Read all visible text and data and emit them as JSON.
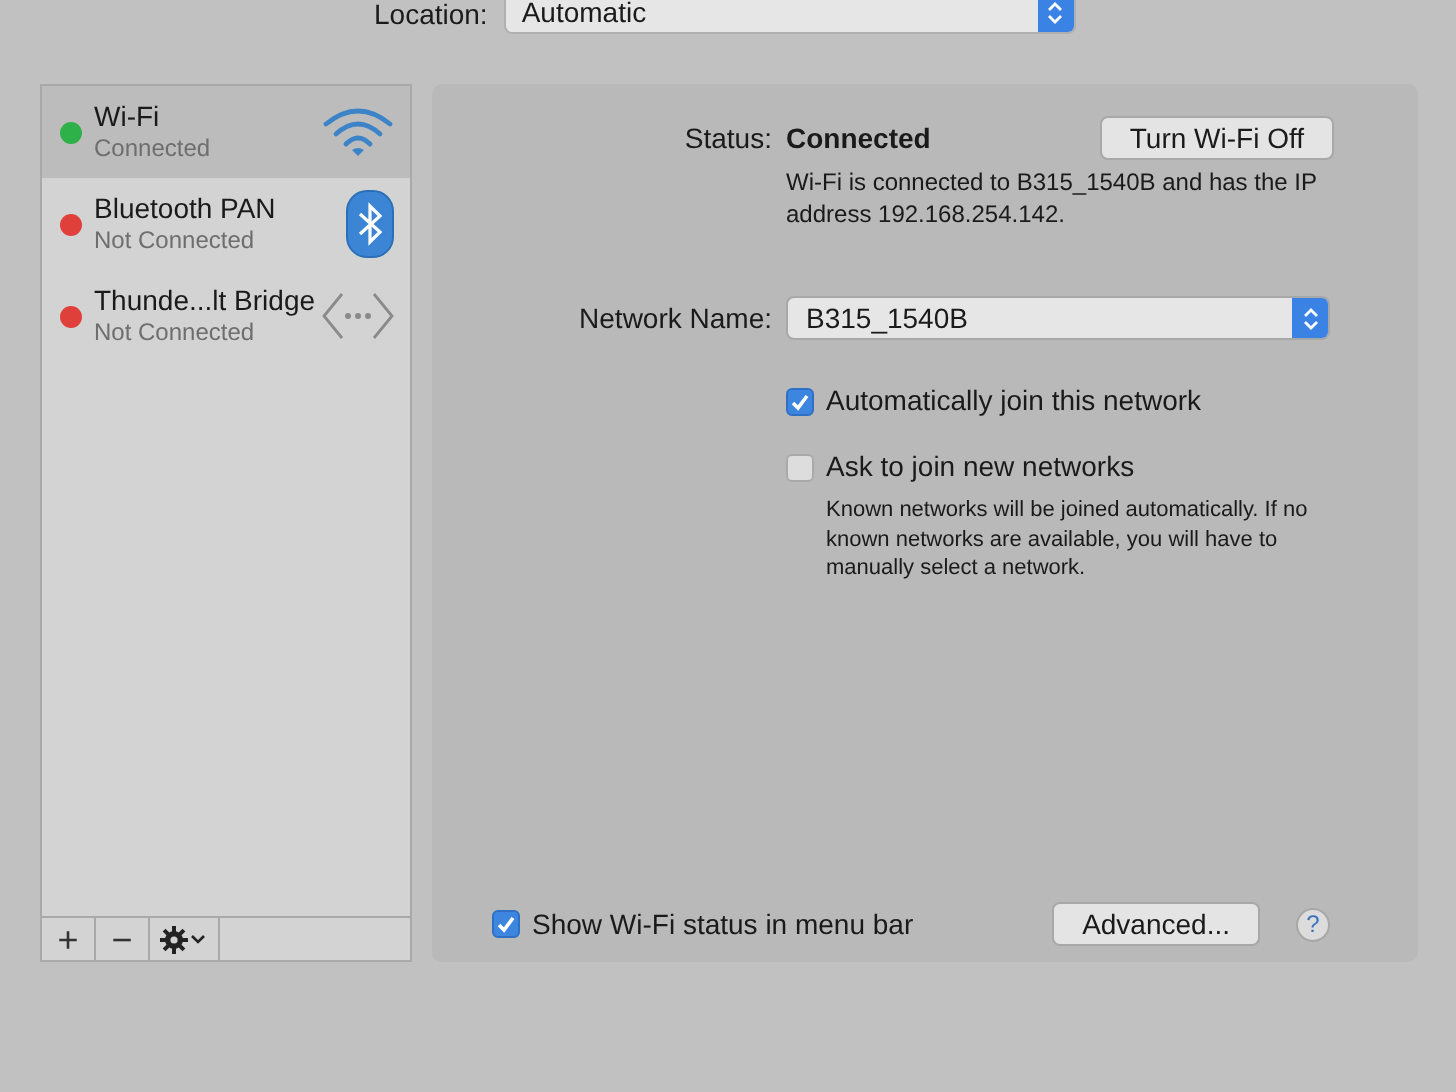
{
  "location": {
    "label": "Location:",
    "value": "Automatic"
  },
  "services": [
    {
      "name": "Wi-Fi",
      "status": "Connected",
      "color": "#2fb14a",
      "selected": true,
      "kind": "wifi"
    },
    {
      "name": "Bluetooth PAN",
      "status": "Not Connected",
      "color": "#e0403a",
      "selected": false,
      "kind": "bluetooth"
    },
    {
      "name": "Thunde...lt Bridge",
      "status": "Not Connected",
      "color": "#e0403a",
      "selected": false,
      "kind": "bridge"
    }
  ],
  "sidebar_buttons": [
    "+",
    "−"
  ],
  "status": {
    "label": "Status:",
    "value": "Connected",
    "button": "Turn Wi-Fi Off",
    "description": "Wi-Fi is connected to B315_1540B and has the IP address 192.168.254.142."
  },
  "network_name": {
    "label": "Network Name:",
    "value": "B315_1540B"
  },
  "options": [
    {
      "label": "Automatically join this network",
      "checked": true
    },
    {
      "label": "Ask to join new networks",
      "checked": false
    }
  ],
  "options_note": "Known networks will be joined automatically. If no known networks are available, you will have to manually select a network.",
  "show_status": {
    "label": "Show Wi-Fi status in menu bar",
    "checked": true
  },
  "advanced_button": "Advanced...",
  "help_button": "?"
}
